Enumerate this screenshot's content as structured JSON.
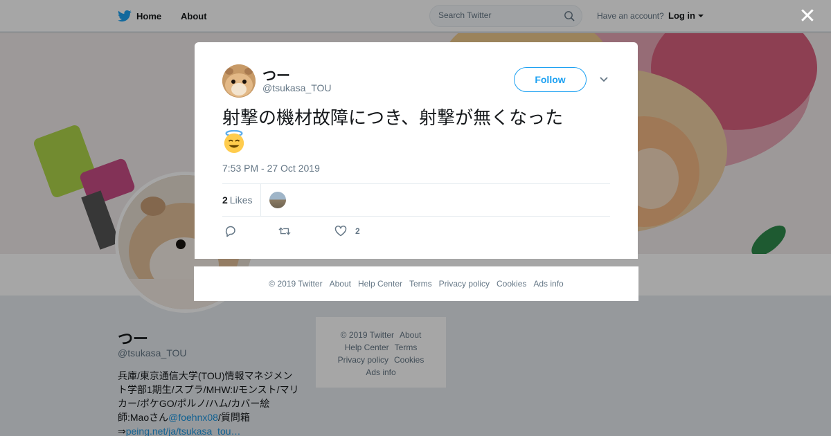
{
  "nav": {
    "home_label": "Home",
    "about_label": "About",
    "search_placeholder": "Search Twitter",
    "account_prompt": "Have an account?",
    "login_label": "Log in"
  },
  "profile": {
    "name": "つー",
    "handle": "@tsukasa_TOU",
    "bio_text": "兵庫/東京通信大学(TOU)情報マネジメント学部1期生/スプラ/MHW:I/モンスト/マリカー/ポケGO/ポルノ/ハム/カバー絵師:Maoさん",
    "bio_mention": "@foehnx08",
    "bio_after": "/質問箱⇒",
    "bio_link": "peing.net/ja/tsukasa_tou…"
  },
  "side_footer": {
    "copyright": "© 2019 Twitter",
    "about": "About",
    "help": "Help Center",
    "terms": "Terms",
    "privacy": "Privacy policy",
    "cookies": "Cookies",
    "ads": "Ads info"
  },
  "tweet": {
    "author_name": "つー",
    "author_handle": "@tsukasa_TOU",
    "follow_label": "Follow",
    "text": "射撃の機材故障につき、射撃が無くなった",
    "timestamp": "7:53 PM - 27 Oct 2019",
    "likes_count": "2",
    "likes_label": "Likes",
    "like_action_count": "2"
  },
  "modal_footer": {
    "copyright": "© 2019 Twitter",
    "about": "About",
    "help": "Help Center",
    "terms": "Terms",
    "privacy": "Privacy policy",
    "cookies": "Cookies",
    "ads": "Ads info"
  },
  "colors": {
    "twitter_blue": "#1da1f2",
    "link_blue": "#1b95e0",
    "muted_text": "#657786",
    "overlay": "rgba(0,0,0,0.35)"
  },
  "icons": [
    "twitter-bird-icon",
    "search-icon",
    "caret-down-icon",
    "close-icon",
    "reply-icon",
    "retweet-icon",
    "heart-icon",
    "chevron-down-icon",
    "halo-emoji-icon"
  ]
}
